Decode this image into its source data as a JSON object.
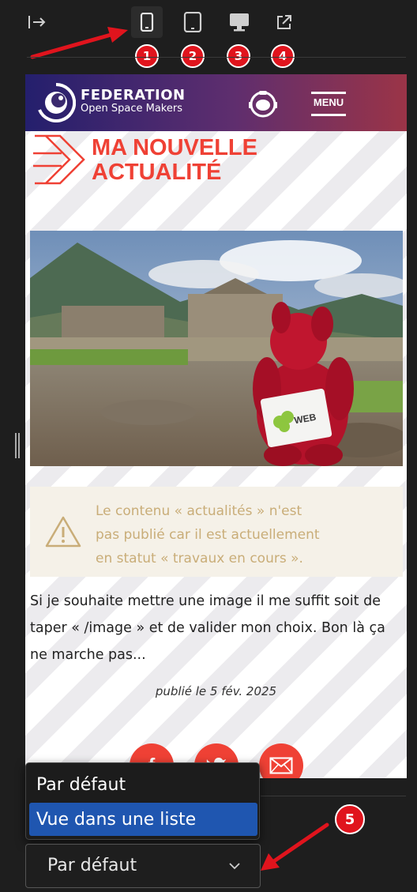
{
  "toolbar": {
    "collapse_icon": "sidebar-collapse-icon",
    "devices": [
      {
        "name": "mobile",
        "icon": "smartphone-icon",
        "active": true,
        "badge": "1"
      },
      {
        "name": "tablet",
        "icon": "tablet-icon",
        "active": false,
        "badge": "2"
      },
      {
        "name": "desktop",
        "icon": "monitor-icon",
        "active": false,
        "badge": "3"
      },
      {
        "name": "external",
        "icon": "external-link-icon",
        "active": false,
        "badge": "4"
      }
    ]
  },
  "preview": {
    "brand_name": "FEDERATION",
    "brand_tagline": "Open Space Makers",
    "menu_label": "MENU",
    "article_title_line1": "MA NOUVELLE",
    "article_title_line2": "ACTUALITÉ",
    "image_badge_text": "WEB",
    "warning_line1": "Le contenu « actualités » n'est",
    "warning_line2": "pas publié car il est actuellement",
    "warning_line3": "en statut « travaux en cours ».",
    "body_text": "Si je souhaite mettre une image il me suffit soit de taper « /image » et de valider mon choix. Bon là ça ne marche pas...",
    "published_date": "publié le 5 fév. 2025",
    "share_icons": [
      "facebook-icon",
      "twitter-icon",
      "email-icon"
    ]
  },
  "display_dropdown": {
    "options": [
      "Par défaut",
      "Vue dans une liste"
    ],
    "highlighted_option": "Vue dans une liste",
    "selected_value": "Par défaut",
    "badge": "5"
  },
  "colors": {
    "accent_red": "#ef4135",
    "badge_red": "#e0141d",
    "selection_blue": "#1f56b0",
    "warning_text": "#c9ad78",
    "header_start": "#241f6d",
    "header_end": "#9b3447"
  }
}
